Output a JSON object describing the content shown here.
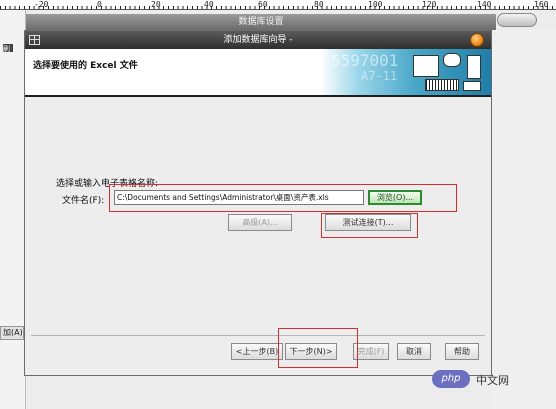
{
  "ruler": {
    "marks": [
      "-20",
      "0",
      "20",
      "40",
      "60",
      "80",
      "100",
      "120",
      "140",
      "160"
    ]
  },
  "background_app": {
    "window_title": "数据库设置",
    "left_icon_text": "刷",
    "left_bottom_text": "加(A)"
  },
  "dialog": {
    "title": "添加数据库向导 -",
    "header_title": "选择要使用的 Excel 文件",
    "banner_texts": [
      "5597001",
      "A7-11"
    ],
    "prompt": "选择或输入电子表格名称:",
    "file_label": "文件名(F):",
    "file_value": "C:\\Documents and Settings\\Administrator\\桌面\\资产表.xls",
    "browse_label": "浏览(O)...",
    "advanced_label": "高级(A)...",
    "test_label": "测试连接(T)...",
    "buttons": {
      "prev": "<上一步(B)",
      "next": "下一步(N)>",
      "finish": "完成(F)",
      "cancel": "取消",
      "help": "帮助"
    }
  },
  "watermark": {
    "logo": "php",
    "text": "中文网"
  },
  "colors": {
    "highlight_box": "#d13030",
    "browse_border": "#2e8a2e",
    "close_orb": "#f08a18"
  }
}
